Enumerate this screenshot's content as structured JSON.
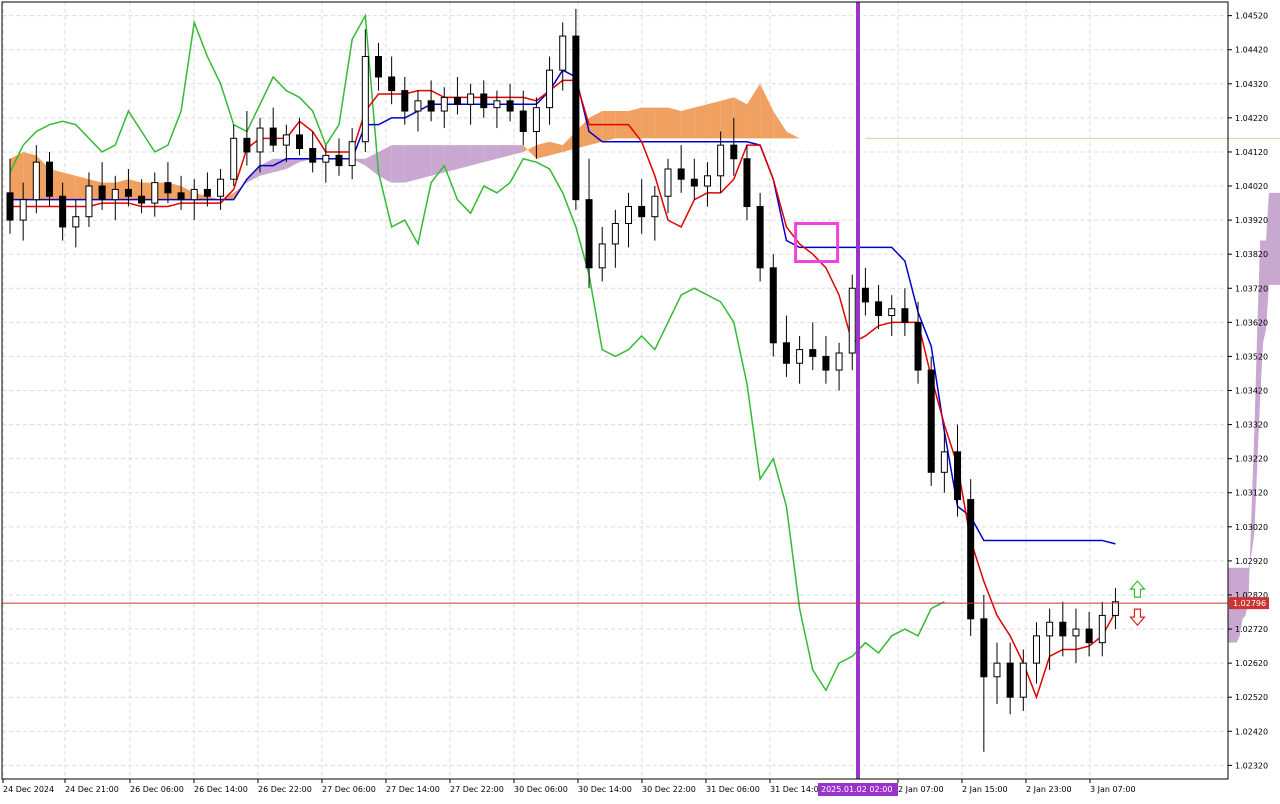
{
  "chart_data": {
    "type": "candlestick",
    "instrument_overlay": "Ichimoku Kinko Hyo",
    "ylim": [
      1.0228,
      1.0456
    ],
    "y_ticks": [
      "1.04520",
      "1.04420",
      "1.04320",
      "1.04220",
      "1.04120",
      "1.04020",
      "1.03920",
      "1.03820",
      "1.03720",
      "1.03620",
      "1.03520",
      "1.03420",
      "1.03320",
      "1.03220",
      "1.03120",
      "1.03020",
      "1.02920",
      "1.02820",
      "1.02720",
      "1.02620",
      "1.02520",
      "1.02420",
      "1.02320"
    ],
    "x_ticks": [
      "24 Dec 2024",
      "24 Dec 21:00",
      "26 Dec 06:00",
      "26 Dec 14:00",
      "26 Dec 22:00",
      "27 Dec 06:00",
      "27 Dec 14:00",
      "27 Dec 22:00",
      "30 Dec 06:00",
      "30 Dec 14:00",
      "30 Dec 22:00",
      "31 Dec 06:00",
      "31 Dec 14:00",
      "2 Jan 07:00",
      "2 Jan 15:00",
      "2 Jan 23:00",
      "3 Jan 07:00"
    ],
    "current_price": "1.02796",
    "highlight_time_label": "2025.01.02 02:00",
    "candles": [
      [
        1.04,
        1.041,
        1.0388,
        1.0392
      ],
      [
        1.0392,
        1.0403,
        1.0386,
        1.0398
      ],
      [
        1.0398,
        1.0414,
        1.0394,
        1.0409
      ],
      [
        1.0409,
        1.0412,
        1.0396,
        1.0399
      ],
      [
        1.0399,
        1.0403,
        1.0386,
        1.039
      ],
      [
        1.039,
        1.0398,
        1.0384,
        1.0393
      ],
      [
        1.0393,
        1.0406,
        1.039,
        1.0402
      ],
      [
        1.0402,
        1.0409,
        1.0395,
        1.0398
      ],
      [
        1.0398,
        1.0405,
        1.0392,
        1.0401
      ],
      [
        1.0401,
        1.0407,
        1.0396,
        1.0399
      ],
      [
        1.0399,
        1.0404,
        1.0394,
        1.0397
      ],
      [
        1.0397,
        1.0406,
        1.0393,
        1.0403
      ],
      [
        1.0403,
        1.0409,
        1.0397,
        1.04
      ],
      [
        1.04,
        1.0405,
        1.0395,
        1.0398
      ],
      [
        1.0398,
        1.0404,
        1.0392,
        1.0401
      ],
      [
        1.0401,
        1.0406,
        1.0396,
        1.0399
      ],
      [
        1.0399,
        1.0407,
        1.0395,
        1.0404
      ],
      [
        1.0404,
        1.042,
        1.0402,
        1.0416
      ],
      [
        1.0416,
        1.0424,
        1.0408,
        1.0412
      ],
      [
        1.0412,
        1.0422,
        1.0406,
        1.0419
      ],
      [
        1.0419,
        1.0425,
        1.0412,
        1.0414
      ],
      [
        1.0414,
        1.042,
        1.0409,
        1.0417
      ],
      [
        1.0417,
        1.0422,
        1.0411,
        1.0413
      ],
      [
        1.0413,
        1.0418,
        1.0406,
        1.0409
      ],
      [
        1.0409,
        1.0414,
        1.0403,
        1.0411
      ],
      [
        1.0411,
        1.0416,
        1.0405,
        1.0408
      ],
      [
        1.0408,
        1.0419,
        1.0404,
        1.0415
      ],
      [
        1.0415,
        1.0448,
        1.0412,
        1.044
      ],
      [
        1.044,
        1.0444,
        1.043,
        1.0434
      ],
      [
        1.0434,
        1.044,
        1.0426,
        1.043
      ],
      [
        1.043,
        1.0434,
        1.042,
        1.0424
      ],
      [
        1.0424,
        1.043,
        1.0418,
        1.0427
      ],
      [
        1.0427,
        1.0433,
        1.0421,
        1.0424
      ],
      [
        1.0424,
        1.0431,
        1.0419,
        1.0428
      ],
      [
        1.0428,
        1.0434,
        1.0423,
        1.0426
      ],
      [
        1.0426,
        1.0432,
        1.042,
        1.0429
      ],
      [
        1.0429,
        1.0433,
        1.0422,
        1.0425
      ],
      [
        1.0425,
        1.043,
        1.0419,
        1.0427
      ],
      [
        1.0427,
        1.0432,
        1.0421,
        1.0424
      ],
      [
        1.0424,
        1.043,
        1.0414,
        1.0418
      ],
      [
        1.0418,
        1.0428,
        1.041,
        1.0425
      ],
      [
        1.0425,
        1.044,
        1.042,
        1.0436
      ],
      [
        1.0436,
        1.045,
        1.043,
        1.0446
      ],
      [
        1.0446,
        1.0454,
        1.0395,
        1.0398
      ],
      [
        1.0398,
        1.041,
        1.0372,
        1.0378
      ],
      [
        1.0378,
        1.039,
        1.0374,
        1.0385
      ],
      [
        1.0385,
        1.0395,
        1.0378,
        1.0391
      ],
      [
        1.0391,
        1.04,
        1.0384,
        1.0396
      ],
      [
        1.0396,
        1.0404,
        1.0388,
        1.0393
      ],
      [
        1.0393,
        1.0402,
        1.0386,
        1.0399
      ],
      [
        1.0399,
        1.041,
        1.0394,
        1.0407
      ],
      [
        1.0407,
        1.0414,
        1.04,
        1.0404
      ],
      [
        1.0404,
        1.041,
        1.0398,
        1.0402
      ],
      [
        1.0402,
        1.0409,
        1.0396,
        1.0405
      ],
      [
        1.0405,
        1.0418,
        1.04,
        1.0414
      ],
      [
        1.0414,
        1.0422,
        1.0405,
        1.041
      ],
      [
        1.041,
        1.0414,
        1.0392,
        1.0396
      ],
      [
        1.0396,
        1.04,
        1.0374,
        1.0378
      ],
      [
        1.0378,
        1.0382,
        1.0352,
        1.0356
      ],
      [
        1.0356,
        1.0364,
        1.0346,
        1.035
      ],
      [
        1.035,
        1.0358,
        1.0344,
        1.0354
      ],
      [
        1.0354,
        1.0362,
        1.0348,
        1.0352
      ],
      [
        1.0352,
        1.0358,
        1.0344,
        1.0348
      ],
      [
        1.0348,
        1.0356,
        1.0342,
        1.0353
      ],
      [
        1.0353,
        1.0376,
        1.0348,
        1.0372
      ],
      [
        1.0372,
        1.0378,
        1.0364,
        1.0368
      ],
      [
        1.0368,
        1.0373,
        1.036,
        1.0364
      ],
      [
        1.0364,
        1.037,
        1.0358,
        1.0366
      ],
      [
        1.0366,
        1.0372,
        1.0358,
        1.0362
      ],
      [
        1.0362,
        1.0368,
        1.0344,
        1.0348
      ],
      [
        1.0348,
        1.0352,
        1.0314,
        1.0318
      ],
      [
        1.0318,
        1.033,
        1.0312,
        1.0324
      ],
      [
        1.0324,
        1.0332,
        1.0305,
        1.031
      ],
      [
        1.031,
        1.0316,
        1.027,
        1.0275
      ],
      [
        1.0275,
        1.0282,
        1.0236,
        1.0258
      ],
      [
        1.0258,
        1.0268,
        1.025,
        1.0262
      ],
      [
        1.0262,
        1.0268,
        1.0247,
        1.0252
      ],
      [
        1.0252,
        1.0266,
        1.0248,
        1.0262
      ],
      [
        1.0262,
        1.0274,
        1.0256,
        1.027
      ],
      [
        1.027,
        1.0278,
        1.026,
        1.0274
      ],
      [
        1.0274,
        1.028,
        1.0264,
        1.027
      ],
      [
        1.027,
        1.0278,
        1.0262,
        1.0272
      ],
      [
        1.0272,
        1.0277,
        1.0264,
        1.0268
      ],
      [
        1.0268,
        1.028,
        1.0264,
        1.0276
      ],
      [
        1.0276,
        1.0284,
        1.0272,
        1.028
      ]
    ],
    "tenkan_sen": [
      1.0396,
      1.0396,
      1.0396,
      1.0396,
      1.0396,
      1.0396,
      1.0396,
      1.0397,
      1.0397,
      1.0397,
      1.0396,
      1.0396,
      1.0396,
      1.0397,
      1.0397,
      1.0397,
      1.0397,
      1.0401,
      1.0413,
      1.0416,
      1.0416,
      1.0416,
      1.0421,
      1.0418,
      1.0412,
      1.0412,
      1.0412,
      1.0424,
      1.0429,
      1.0429,
      1.0429,
      1.043,
      1.043,
      1.0428,
      1.0428,
      1.0428,
      1.0428,
      1.0428,
      1.0428,
      1.0428,
      1.0427,
      1.043,
      1.0433,
      1.0433,
      1.042,
      1.042,
      1.042,
      1.042,
      1.0415,
      1.0405,
      1.0392,
      1.039,
      1.0398,
      1.04,
      1.04,
      1.0404,
      1.0414,
      1.0414,
      1.0404,
      1.039,
      1.0385,
      1.0382,
      1.0378,
      1.037,
      1.0356,
      1.0358,
      1.0361,
      1.0362,
      1.0362,
      1.0362,
      1.0346,
      1.0332,
      1.032,
      1.0298,
      1.0286,
      1.0276,
      1.027,
      1.0262,
      1.0252,
      1.0264,
      1.0266,
      1.0266,
      1.0267,
      1.027,
      1.0277
    ],
    "kijun_sen": [
      1.0398,
      1.0398,
      1.0398,
      1.0398,
      1.0398,
      1.0398,
      1.0398,
      1.0398,
      1.0398,
      1.0398,
      1.0398,
      1.0398,
      1.0398,
      1.0398,
      1.0398,
      1.0398,
      1.0398,
      1.0398,
      1.0404,
      1.0408,
      1.0408,
      1.041,
      1.041,
      1.041,
      1.041,
      1.041,
      1.041,
      1.042,
      1.042,
      1.0422,
      1.0422,
      1.0424,
      1.0426,
      1.0426,
      1.0426,
      1.0426,
      1.0426,
      1.0426,
      1.0426,
      1.0426,
      1.0426,
      1.043,
      1.0436,
      1.0434,
      1.0418,
      1.0415,
      1.0415,
      1.0415,
      1.0415,
      1.0415,
      1.0415,
      1.0415,
      1.0415,
      1.0415,
      1.0415,
      1.0415,
      1.0415,
      1.0414,
      1.0404,
      1.0386,
      1.0384,
      1.0384,
      1.0384,
      1.0384,
      1.0384,
      1.0384,
      1.0384,
      1.0384,
      1.038,
      1.0365,
      1.0355,
      1.033,
      1.0308,
      1.0305,
      1.0298,
      1.0298,
      1.0298,
      1.0298,
      1.0298,
      1.0298,
      1.0298,
      1.0298,
      1.0298,
      1.0298,
      1.0297
    ],
    "chikou_span": [
      1.0406,
      1.0414,
      1.0418,
      1.042,
      1.0421,
      1.042,
      1.0416,
      1.0412,
      1.0414,
      1.0424,
      1.0418,
      1.0412,
      1.0414,
      1.0424,
      1.045,
      1.044,
      1.0432,
      1.042,
      1.0418,
      1.0426,
      1.0434,
      1.043,
      1.0428,
      1.0424,
      1.0414,
      1.042,
      1.0445,
      1.0452,
      1.0406,
      1.039,
      1.0392,
      1.0385,
      1.0403,
      1.0408,
      1.0398,
      1.0394,
      1.0402,
      1.04,
      1.0403,
      1.041,
      1.0409,
      1.0407,
      1.04,
      1.039,
      1.0376,
      1.0354,
      1.0352,
      1.0354,
      1.0358,
      1.0354,
      1.0362,
      1.037,
      1.0372,
      1.037,
      1.0368,
      1.0362,
      1.0344,
      1.0316,
      1.0322,
      1.0308,
      1.0278,
      1.026,
      1.0254,
      1.0262,
      1.0264,
      1.0268,
      1.0265,
      1.027,
      1.0272,
      1.027,
      1.0278,
      1.028
    ],
    "senkou_span_a": [
      1.041,
      1.0412,
      1.0411,
      1.0407,
      1.0406,
      1.0405,
      1.0404,
      1.0403,
      1.0403,
      1.0404,
      1.0403,
      1.0403,
      1.0403,
      1.0402,
      1.04,
      1.0399,
      1.0398,
      1.04,
      1.0403,
      1.0405,
      1.0406,
      1.0407,
      1.0409,
      1.041,
      1.041,
      1.041,
      1.041,
      1.0408,
      1.0405,
      1.0403,
      1.0403,
      1.0404,
      1.0405,
      1.0406,
      1.0407,
      1.0408,
      1.0409,
      1.041,
      1.0411,
      1.0412,
      1.0414,
      1.0415,
      1.0414,
      1.0418,
      1.0422,
      1.0424,
      1.0424,
      1.0424,
      1.0425,
      1.0425,
      1.0425,
      1.0424,
      1.0425,
      1.0426,
      1.0427,
      1.0428,
      1.0426,
      1.0432,
      1.0424,
      1.0418,
      1.0416,
      1.0416,
      1.0416,
      1.0416,
      1.0416,
      1.0416
    ],
    "senkou_span_b": [
      1.0398,
      1.0398,
      1.0398,
      1.0398,
      1.0398,
      1.0398,
      1.0398,
      1.0398,
      1.0398,
      1.0398,
      1.0398,
      1.0398,
      1.0398,
      1.0398,
      1.0398,
      1.0398,
      1.0398,
      1.0398,
      1.0404,
      1.0408,
      1.041,
      1.041,
      1.041,
      1.041,
      1.041,
      1.041,
      1.041,
      1.041,
      1.0412,
      1.0414,
      1.0414,
      1.0414,
      1.0414,
      1.0414,
      1.0414,
      1.0414,
      1.0414,
      1.0414,
      1.0414,
      1.0414,
      1.041,
      1.0411,
      1.0412,
      1.0413,
      1.0414,
      1.0415,
      1.0416,
      1.0416,
      1.0416,
      1.0416,
      1.0416,
      1.0416,
      1.0416,
      1.0416,
      1.0416,
      1.0416,
      1.0416,
      1.0416,
      1.0416,
      1.0416,
      1.0416,
      1.0416,
      1.0416,
      1.0416,
      1.0416,
      1.0416,
      1.0416,
      1.0416,
      1.0416,
      1.0416,
      1.0416,
      1.0416,
      1.0416,
      1.0416,
      1.0416,
      1.0416,
      1.0416,
      1.0416,
      1.0416,
      1.0416,
      1.0416,
      1.0416,
      1.0416,
      1.0416,
      1.0416,
      1.0416,
      1.0416,
      1.0416,
      1.0416,
      1.0416,
      1.0416,
      1.0416,
      1.0416,
      1.0416,
      1.0416,
      1.0416,
      1.0416,
      1.0416,
      1.0416,
      1.0416
    ],
    "future_cloud_upper": [
      1.0416,
      1.0416,
      1.0416,
      1.0416,
      1.0416,
      1.0416,
      1.0416,
      1.0416,
      1.0416,
      1.0402,
      1.04,
      1.04,
      1.04,
      1.04,
      1.04,
      1.04,
      1.0386,
      1.0386,
      1.0386,
      1.036,
      1.033,
      1.0306,
      1.028,
      1.0276,
      1.0275,
      1.027,
      1.0268,
      1.0268,
      1.0268,
      1.0268
    ],
    "future_cloud_lower": [
      1.0416,
      1.0416,
      1.0415,
      1.0415,
      1.0414,
      1.0412,
      1.0402,
      1.0399,
      1.0394,
      1.0388,
      1.0378,
      1.0373,
      1.0373,
      1.0373,
      1.0373,
      1.0373,
      1.036,
      1.0356,
      1.034,
      1.032,
      1.03,
      1.0294,
      1.029,
      1.029,
      1.029,
      1.029,
      1.029,
      1.029,
      1.029,
      1.029
    ],
    "colors": {
      "tenkan": "#e00000",
      "kijun": "#0000cc",
      "chikou": "#33bb33",
      "cloud_bull": "#f0a060",
      "cloud_bear": "#c8a8d0",
      "vline": "#9933cc",
      "marker": "#ee44dd",
      "price_line": "#cc3333",
      "grid": "#dcdcdc"
    }
  }
}
